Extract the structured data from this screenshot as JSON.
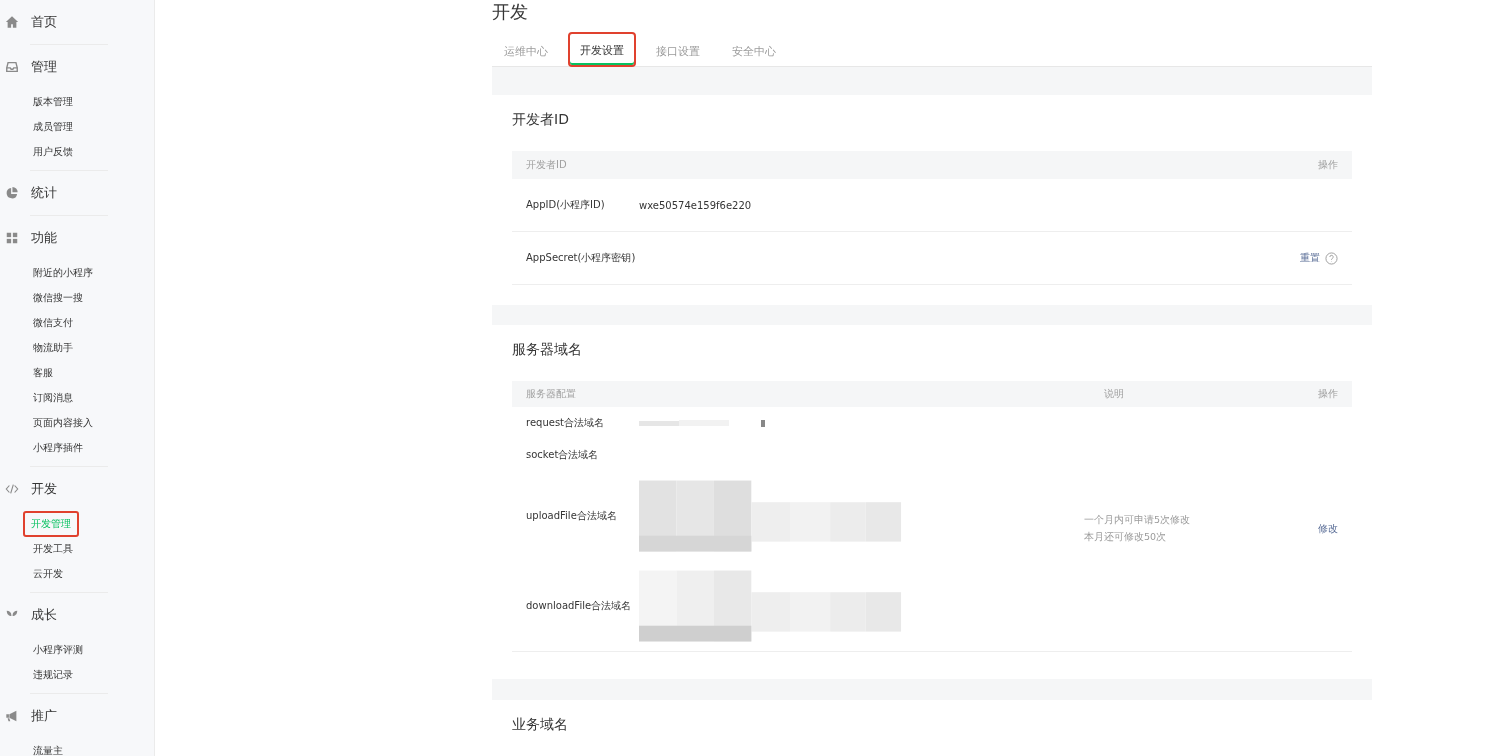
{
  "sidebar": {
    "sections": [
      {
        "title": "首页"
      },
      {
        "title": "管理",
        "items": [
          {
            "label": "版本管理",
            "selected": false,
            "highlighted": false
          },
          {
            "label": "成员管理",
            "selected": false,
            "highlighted": false
          },
          {
            "label": "用户反馈",
            "selected": false,
            "highlighted": false
          }
        ]
      },
      {
        "title": "统计"
      },
      {
        "title": "功能",
        "items": [
          {
            "label": "附近的小程序",
            "selected": false,
            "highlighted": false
          },
          {
            "label": "微信搜一搜",
            "selected": false,
            "highlighted": false
          },
          {
            "label": "微信支付",
            "selected": false,
            "highlighted": false
          },
          {
            "label": "物流助手",
            "selected": false,
            "highlighted": false
          },
          {
            "label": "客服",
            "selected": false,
            "highlighted": false
          },
          {
            "label": "订阅消息",
            "selected": false,
            "highlighted": false
          },
          {
            "label": "页面内容接入",
            "selected": false,
            "highlighted": false
          },
          {
            "label": "小程序插件",
            "selected": false,
            "highlighted": false
          }
        ]
      },
      {
        "title": "开发",
        "items": [
          {
            "label": "开发管理",
            "selected": true,
            "highlighted": true
          },
          {
            "label": "开发工具",
            "selected": false,
            "highlighted": false
          },
          {
            "label": "云开发",
            "selected": false,
            "highlighted": false
          }
        ]
      },
      {
        "title": "成长",
        "items": [
          {
            "label": "小程序评测",
            "selected": false,
            "highlighted": false
          },
          {
            "label": "违规记录",
            "selected": false,
            "highlighted": false
          }
        ]
      },
      {
        "title": "推广",
        "items": [
          {
            "label": "流量主",
            "selected": false,
            "highlighted": false
          }
        ]
      }
    ]
  },
  "page_title": "开发",
  "tabs": [
    {
      "label": "运维中心",
      "selected": false,
      "highlighted": false
    },
    {
      "label": "开发设置",
      "selected": true,
      "highlighted": true
    },
    {
      "label": "接口设置",
      "selected": false,
      "highlighted": false
    },
    {
      "label": "安全中心",
      "selected": false,
      "highlighted": false
    }
  ],
  "developer_id": {
    "title": "开发者ID",
    "columns": [
      "开发者ID",
      "操作"
    ],
    "rows": [
      {
        "label": "AppID(小程序ID)",
        "value": "wxe50574e159f6e220"
      },
      {
        "label": "AppSecret(小程序密钥)",
        "action": "重置",
        "help": true
      }
    ]
  },
  "server_domain": {
    "title": "服务器域名",
    "columns": [
      "服务器配置",
      "说明",
      "操作"
    ],
    "rows": [
      {
        "label": "request合法域名"
      },
      {
        "label": "socket合法域名"
      },
      {
        "label": "uploadFile合法域名"
      },
      {
        "label": "downloadFile合法域名"
      }
    ],
    "notes": [
      "一个月内可申请5次修改",
      "本月还可修改50次"
    ],
    "action": "修改"
  },
  "business_domain": {
    "title": "业务域名"
  }
}
